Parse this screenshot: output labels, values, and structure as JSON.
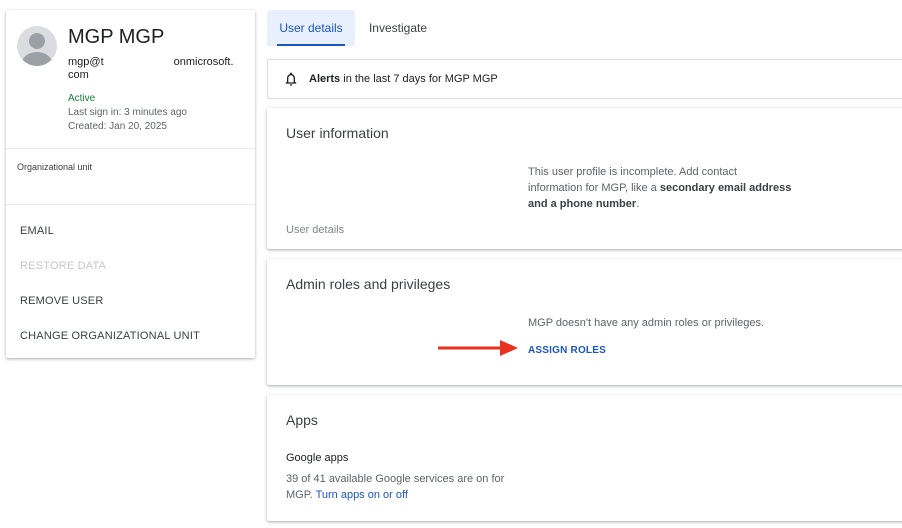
{
  "profile": {
    "name": "MGP MGP",
    "email_start": "mgp@t",
    "email_end": "onmicrosoft.",
    "email_line2": "com",
    "status": "Active",
    "last_sign_in": "Last sign in: 3 minutes ago",
    "created": "Created: Jan 20, 2025",
    "org_unit_label": "Organizational unit",
    "actions": {
      "email": "EMAIL",
      "restore_data": "RESTORE DATA",
      "remove_user": "REMOVE USER",
      "change_org_unit": "CHANGE ORGANIZATIONAL UNIT"
    }
  },
  "tabs": {
    "user_details": "User details",
    "investigate": "Investigate"
  },
  "alerts": {
    "bold": "Alerts",
    "rest": " in the last 7 days for MGP MGP"
  },
  "user_information": {
    "title": "User information",
    "message_part1": "This user profile is incomplete. Add contact information for MGP, like a ",
    "message_bold": "secondary email address and a phone number",
    "message_end": ".",
    "footer": "User details"
  },
  "admin_roles": {
    "title": "Admin roles and privileges",
    "message": "MGP doesn't have any admin roles or privileges.",
    "assign_label": "ASSIGN ROLES"
  },
  "apps": {
    "title": "Apps",
    "google_apps_heading": "Google apps",
    "services_text": "39 of 41 available Google services are on for MGP. ",
    "turn_on_link": "Turn apps on or off"
  },
  "colors": {
    "accent": "#1a56c4",
    "active_green": "#188038",
    "arrow_red": "#e8321e"
  }
}
